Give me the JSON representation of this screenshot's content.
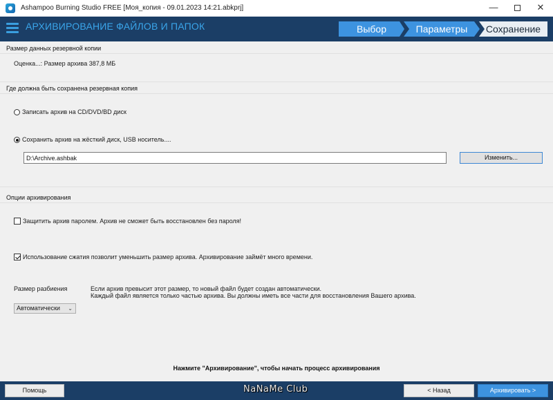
{
  "window": {
    "title": "Ashampoo Burning Studio FREE [Моя_копия - 09.01.2023 14:21.abkprj]",
    "controls": {
      "minimize": "—",
      "close": "✕"
    }
  },
  "header": {
    "title": "АРХИВИРОВАНИЕ ФАЙЛОВ И ПАПОК",
    "steps": [
      "Выбор",
      "Параметры",
      "Сохранение"
    ],
    "active_step": "Сохранение"
  },
  "size_section": {
    "title": "Размер данных резервной копии",
    "estimate": "Оценка...: Размер архива 387,8 МБ"
  },
  "location_section": {
    "title": "Где должна быть сохранена резервная копия",
    "option_disc": "Записать архив на CD/DVD/BD диск",
    "option_disk": "Сохранить архив на жёсткий диск, USB носитель....",
    "selected": "option_disk",
    "path_value": "D:\\Archive.ashbak",
    "change_label": "Изменить..."
  },
  "options_section": {
    "title": "Опции архивирования",
    "password_label": "Защитить архив паролем. Архив не сможет быть восстановлен без пароля!",
    "password_checked": false,
    "compress_label": "Использование сжатия позволит уменьшить размер архива. Архивирование займёт много времени.",
    "compress_checked": true,
    "split_label": "Размер разбиения",
    "split_value": "Автоматически",
    "split_info_1": "Если архив превысит этот размер, то новый файл будет создан автоматически.",
    "split_info_2": "Каждый файл является только частью архива. Вы должны иметь все части для восстановления Вашего архива."
  },
  "hint": "Нажмите \"Архивирование\", чтобы начать процесс архивирования",
  "footer": {
    "help": "Помощь",
    "back": "< Назад",
    "archive": "Архивировать >",
    "watermark": "NaNaMe Club"
  },
  "colors": {
    "header_bg": "#1b3e66",
    "accent": "#3d93e0",
    "title_accent": "#3aa5ea",
    "content_bg": "#f0f0f0"
  },
  "icons": [
    "app-icon",
    "hamburger-menu-icon",
    "minimize-icon",
    "maximize-icon",
    "close-icon",
    "dropdown-arrow-icon"
  ]
}
